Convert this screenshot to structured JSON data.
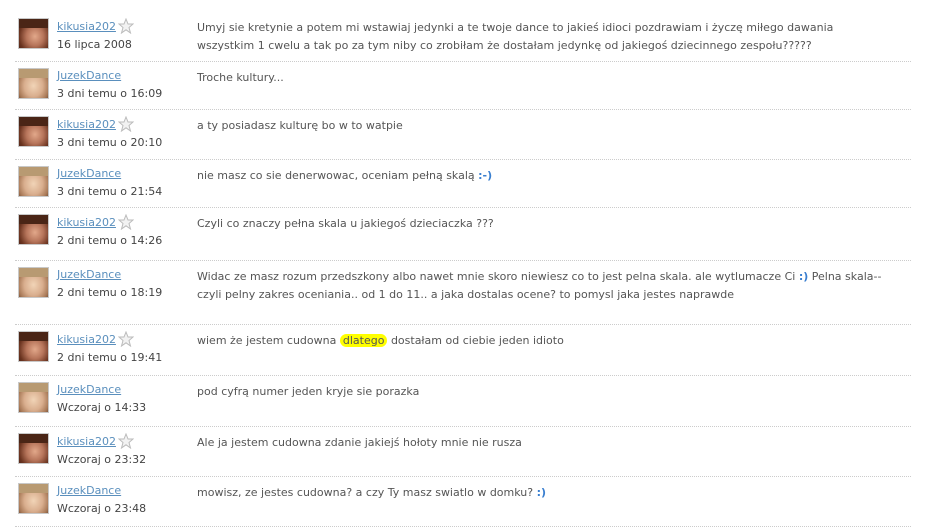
{
  "comments": [
    {
      "author": "kikusia202",
      "star": true,
      "avatar": "girl",
      "date": "16 lipca 2008",
      "text": "Umyj sie kretynie a potem mi wstawiaj jedynki a te twoje dance to jakieś idioci pozdrawiam i życzę miłego dawania wszystkim 1 cwelu a tak po za tym niby co zrobiłam że dostałam jedynkę od jakiegoś dziecinnego zespołu?????"
    },
    {
      "author": "JuzekDance",
      "star": false,
      "avatar": "boy",
      "date": "3 dni temu o 16:09",
      "text": "Troche kultury..."
    },
    {
      "author": "kikusia202",
      "star": true,
      "avatar": "girl",
      "date": "3 dni temu o 20:10",
      "text": "a ty posiadasz kulturę bo w to watpie"
    },
    {
      "author": "JuzekDance",
      "star": false,
      "avatar": "boy",
      "date": "3 dni temu o 21:54",
      "text": "nie masz co sie denerwowac, oceniam pełną skalą",
      "smiley": ":-)"
    },
    {
      "author": "kikusia202",
      "star": true,
      "avatar": "girl",
      "date": "2 dni temu o 14:26",
      "text": "Czyli co znaczy pełna skala u jakiegoś dzieciaczka ???"
    },
    {
      "author": "JuzekDance",
      "star": false,
      "avatar": "boy",
      "date": "2 dni temu o 18:19",
      "text": "Widac ze masz rozum przedszkony albo nawet mnie skoro niewiesz co to jest pelna skala. ale wytlumacze Ci",
      "smiley": ":)",
      "text_after": "Pelna skala--czyli pelny zakres oceniania.. od 1 do 11.. a jaka dostalas ocene? to pomysl jaka jestes naprawde"
    },
    {
      "author": "kikusia202",
      "star": true,
      "avatar": "girl",
      "date": "2 dni temu o 19:41",
      "text": "wiem że jestem cudowna",
      "highlight": "dlatego",
      "text_after": "dostałam od ciebie jeden idioto"
    },
    {
      "author": "JuzekDance",
      "star": false,
      "avatar": "boy",
      "date": "Wczoraj o 14:33",
      "text": "pod cyfrą numer jeden kryje sie porazka"
    },
    {
      "author": "kikusia202",
      "star": true,
      "avatar": "girl",
      "date": "Wczoraj o 23:32",
      "text": "Ale ja jestem cudowna zdanie jakiejś hołoty mnie nie rusza"
    },
    {
      "author": "JuzekDance",
      "star": false,
      "avatar": "boy",
      "date": "Wczoraj o 23:48",
      "text": "mowisz, ze jestes cudowna? a czy Ty masz swiatlo w domku?",
      "smiley": ":)"
    }
  ]
}
